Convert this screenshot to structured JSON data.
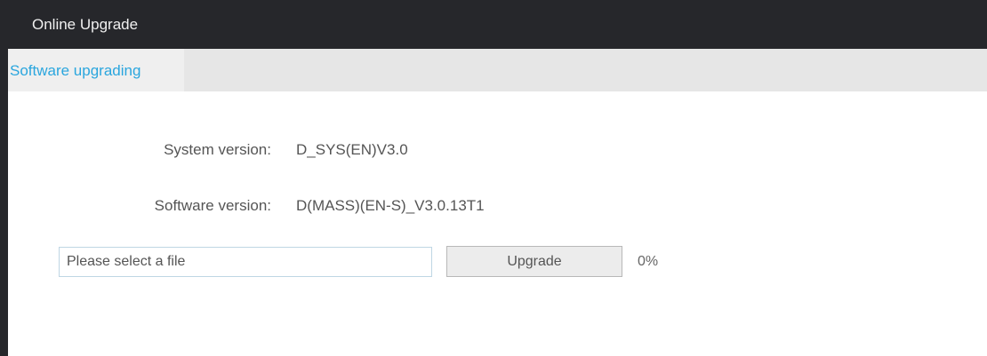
{
  "window": {
    "title": "Online Upgrade"
  },
  "tabs": [
    {
      "label": "Software upgrading",
      "active": true
    }
  ],
  "info": {
    "system_version_label": "System version:",
    "system_version_value": "D_SYS(EN)V3.0",
    "software_version_label": "Software version:",
    "software_version_value": "D(MASS)(EN-S)_V3.0.13T1"
  },
  "upload": {
    "file_placeholder": "Please select a file",
    "upgrade_button": "Upgrade",
    "progress_text": "0%"
  },
  "colors": {
    "titlebar_bg": "#26272b",
    "accent": "#2aa6de",
    "tab_bg": "#efefef"
  }
}
